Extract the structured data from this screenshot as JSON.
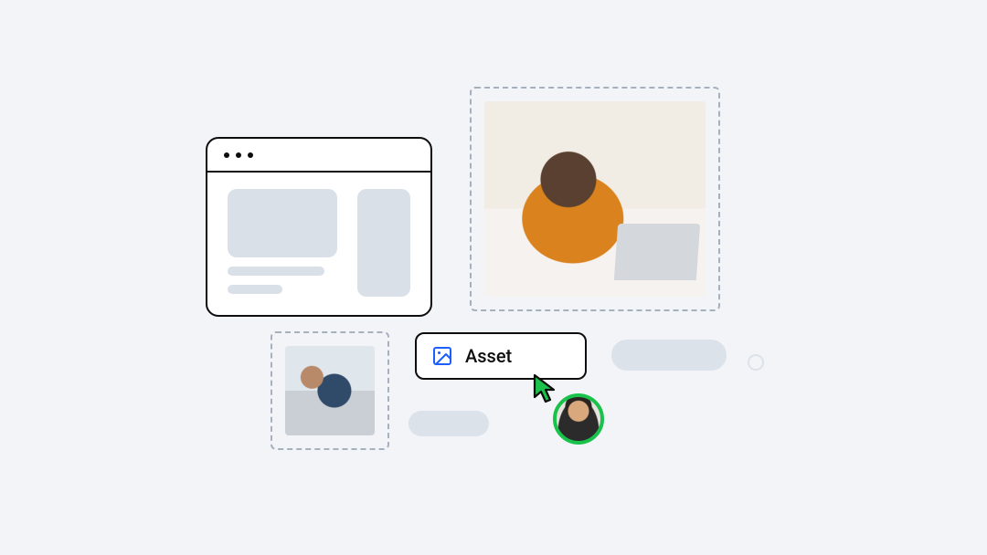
{
  "asset_chip": {
    "label": "Asset",
    "icon": "image-icon"
  },
  "frames": {
    "large_alt": "person-at-laptop-photo",
    "small_alt": "office-team-photo"
  },
  "avatar": {
    "name": "collaborator-avatar",
    "status_color": "#19c24a"
  }
}
